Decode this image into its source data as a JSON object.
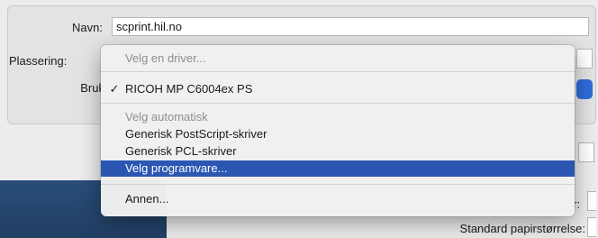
{
  "form": {
    "name_label": "Navn:",
    "name_value": "scprint.hil.no",
    "location_label": "Plassering:",
    "use_label": "Bruk"
  },
  "bottom": {
    "paper_size_label": "Standard papirstørrelse:",
    "right_label_fragment": "r:"
  },
  "menu": {
    "items": [
      {
        "label": "Velg en driver...",
        "disabled": true
      },
      {
        "label": "RICOH MP C6004ex PS",
        "checked": true
      },
      {
        "label": "Velg automatisk",
        "disabled": true
      },
      {
        "label": "Generisk PostScript-skriver"
      },
      {
        "label": "Generisk PCL-skriver"
      },
      {
        "label": "Velg programvare...",
        "selected": true
      },
      {
        "label": "Annen..."
      }
    ],
    "check_glyph": "✓",
    "check_icon": "checkmark-icon"
  },
  "colors": {
    "selection": "#2b57b3",
    "accent": "#2f6bd8"
  }
}
